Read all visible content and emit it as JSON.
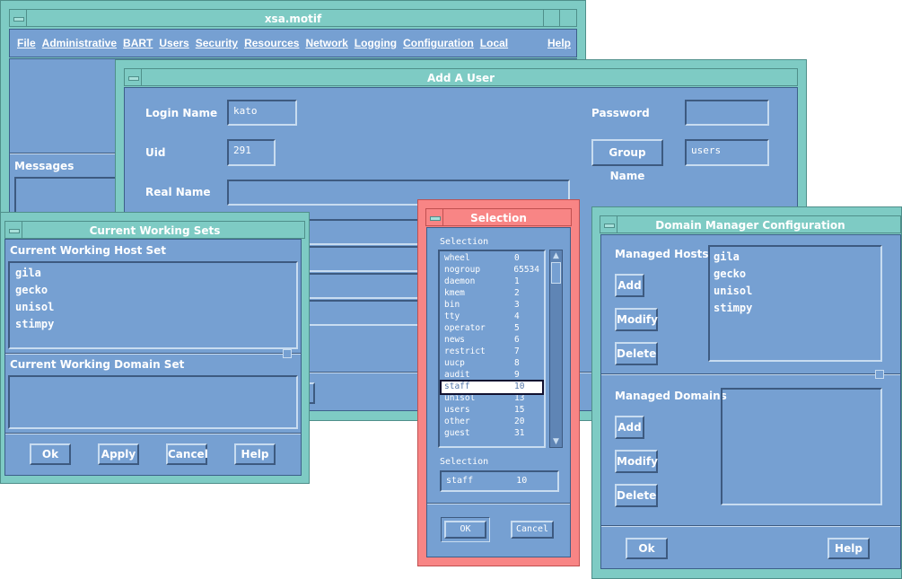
{
  "main": {
    "title": "xsa.motif",
    "menu": [
      "File",
      "Administrative",
      "BART",
      "Users",
      "Security",
      "Resources",
      "Network",
      "Logging",
      "Configuration",
      "Local"
    ],
    "help": "Help",
    "messages_label": "Messages"
  },
  "add_user": {
    "title": "Add A User",
    "login_label": "Login Name",
    "login_value": "kato",
    "password_label": "Password",
    "password_value": "",
    "uid_label": "Uid",
    "uid_value": "291",
    "group_button": "Group Name",
    "group_value": "users",
    "realname_label": "Real Name",
    "realname_value": ""
  },
  "working_sets": {
    "title": "Current Working Sets",
    "host_label": "Current Working Host Set",
    "hosts": [
      "gila",
      "gecko",
      "unisol",
      "stimpy"
    ],
    "domain_label": "Current Working Domain Set",
    "buttons": [
      "Ok",
      "Apply",
      "Cancel",
      "Help"
    ]
  },
  "selection": {
    "title": "Selection",
    "list_label": "Selection",
    "items": [
      [
        "wheel",
        "0"
      ],
      [
        "nogroup",
        "65534"
      ],
      [
        "daemon",
        "1"
      ],
      [
        "kmem",
        "2"
      ],
      [
        "bin",
        "3"
      ],
      [
        "tty",
        "4"
      ],
      [
        "operator",
        "5"
      ],
      [
        "news",
        "6"
      ],
      [
        "restrict",
        "7"
      ],
      [
        "uucp",
        "8"
      ],
      [
        "audit",
        "9"
      ],
      [
        "staff",
        "10"
      ],
      [
        "unisol",
        "13"
      ],
      [
        "users",
        "15"
      ],
      [
        "other",
        "20"
      ],
      [
        "guest",
        "31"
      ]
    ],
    "selected_index": 11,
    "field_label": "Selection",
    "field_value": "staff        10",
    "ok": "OK",
    "cancel": "Cancel"
  },
  "domain_manager": {
    "title": "Domain Manager Configuration",
    "hosts_label": "Managed Hosts",
    "hosts": [
      "gila",
      "gecko",
      "unisol",
      "stimpy"
    ],
    "domains_label": "Managed Domains",
    "add": "Add",
    "modify": "Modify",
    "delete": "Delete",
    "ok": "Ok",
    "help": "Help"
  },
  "colors": {
    "frame": "#7ecbc4",
    "dialog_frame": "#f88585",
    "body": "#76a0d2"
  }
}
